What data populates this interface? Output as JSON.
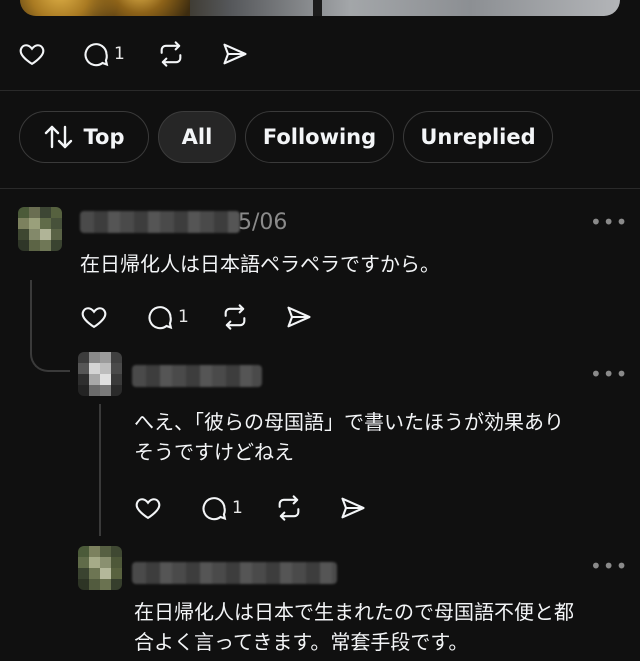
{
  "post": {
    "reply_count": "1"
  },
  "filters": [
    {
      "label": "Top",
      "icon": "sort-icon"
    },
    {
      "label": "All",
      "active": true
    },
    {
      "label": "Following"
    },
    {
      "label": "Unreplied"
    }
  ],
  "comments": [
    {
      "date_fragment": "5/06",
      "text": "在日帰化人は日本語ペラペラですから。",
      "reply_count": "1"
    },
    {
      "text_line1": "へえ、「彼らの母国語」で書いたほうが効果あり",
      "text_line2": "そうですけどねえ",
      "reply_count": "1"
    },
    {
      "text_line1": "在日帰化人は日本で生まれたので母国語不便と都",
      "text_line2": "合よく言ってきます。常套手段です。"
    }
  ],
  "more_label": "•••",
  "colors": {
    "background": "#101010",
    "text": "#f3f5f7",
    "muted": "#8a8a8a",
    "border": "#3a3a3a"
  }
}
